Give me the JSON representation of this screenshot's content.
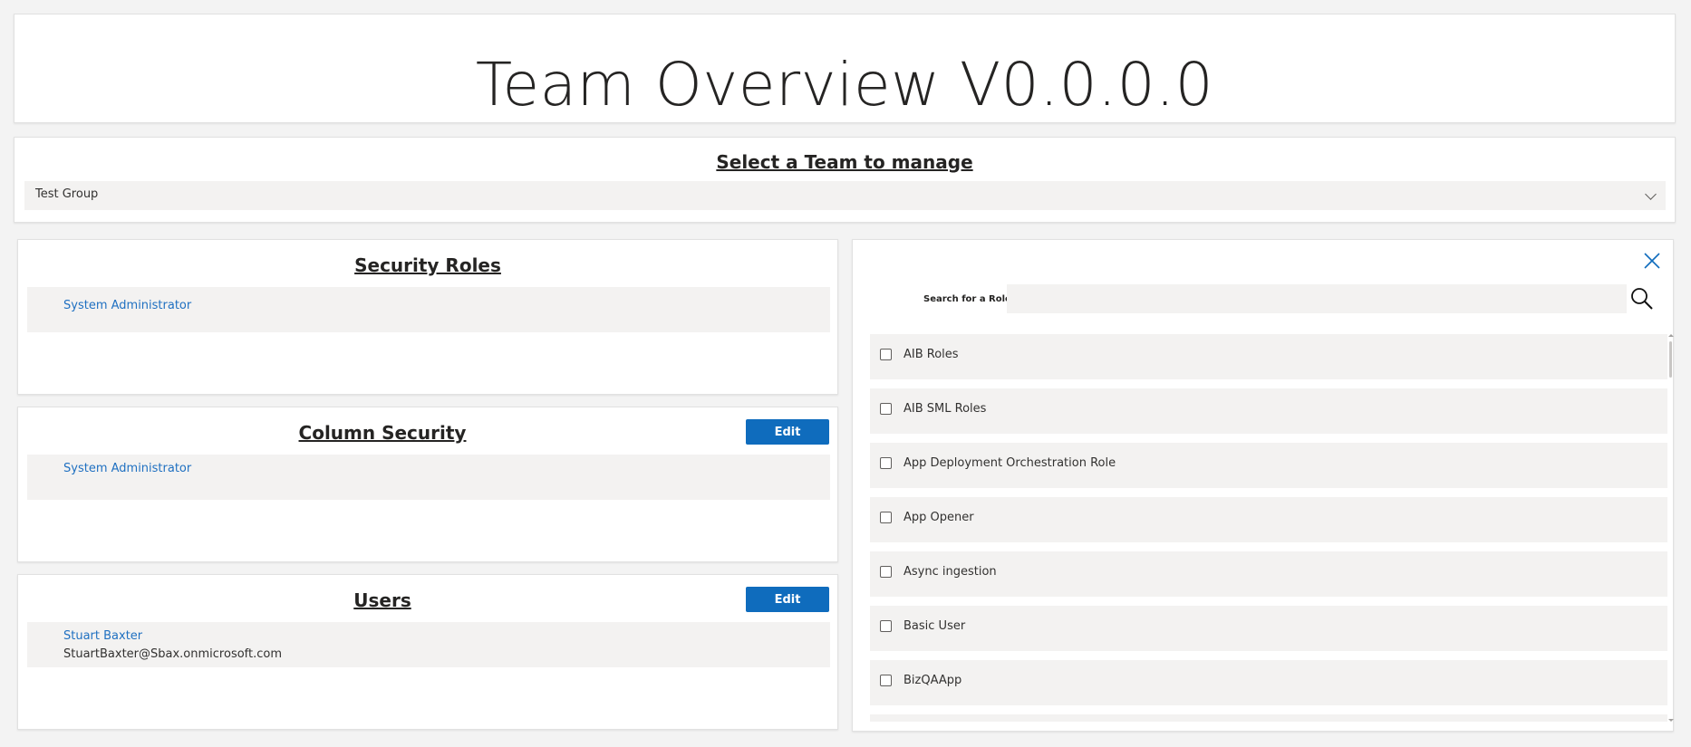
{
  "header": {
    "title": "Team Overview V0.0.0.0"
  },
  "team_select": {
    "label": "Select a Team to manage",
    "selected": "Test Group"
  },
  "security_roles": {
    "title": "Security Roles",
    "items": [
      {
        "name": "System Administrator"
      }
    ]
  },
  "column_security": {
    "title": "Column Security",
    "edit_label": "Edit",
    "items": [
      {
        "name": "System Administrator"
      }
    ]
  },
  "users": {
    "title": "Users",
    "edit_label": "Edit",
    "items": [
      {
        "name": "Stuart Baxter",
        "email": "StuartBaxter@Sbax.onmicrosoft.com"
      }
    ]
  },
  "role_picker": {
    "search_label": "Search for a Role",
    "search_value": "",
    "roles": [
      {
        "label": "AIB Roles",
        "checked": false
      },
      {
        "label": "AIB SML Roles",
        "checked": false
      },
      {
        "label": "App Deployment Orchestration Role",
        "checked": false
      },
      {
        "label": "App Opener",
        "checked": false
      },
      {
        "label": "Async ingestion",
        "checked": false
      },
      {
        "label": "Basic User",
        "checked": false
      },
      {
        "label": "BizQAApp",
        "checked": false
      }
    ]
  },
  "colors": {
    "accent": "#0f6cbd",
    "link": "#1f70c1",
    "background": "#f3f3f3",
    "row": "#f3f2f1"
  },
  "icons": {
    "close": "close-icon",
    "search": "search-icon",
    "chevron": "chevron-down-icon",
    "checkbox": "checkbox-icon"
  }
}
